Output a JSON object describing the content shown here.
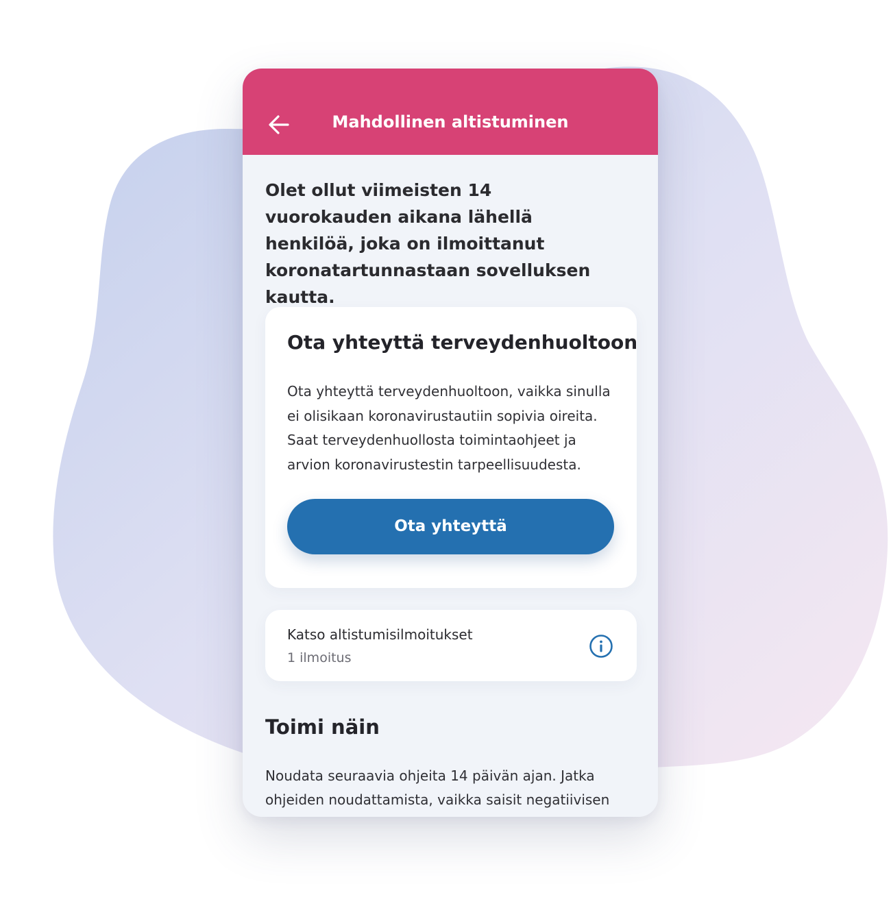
{
  "colors": {
    "header_bg": "#d74275",
    "primary_button": "#2470b0",
    "screen_bg": "#f1f4f9",
    "card_bg": "#ffffff",
    "info_icon": "#2470b0"
  },
  "header": {
    "back_icon": "arrow-left-icon",
    "title": "Mahdollinen altistuminen"
  },
  "intro": {
    "text": "Olet ollut viimeisten 14 vuorokauden aikana lähellä henkilöä, joka on ilmoittanut koronatartunnastaan sovelluksen kautta."
  },
  "contact_card": {
    "title": "Ota yhteyttä terveydenhuoltoon",
    "body": "Ota yhteyttä terveydenhuoltoon, vaikka sinulla ei olisikaan koronavirustautiin sopivia oireita. Saat terveydenhuollosta toimintaohjeet ja arvion koronavirustestin tarpeellisuudesta.",
    "button_label": "Ota yhteyttä"
  },
  "exposures_card": {
    "title": "Katso altistumisilmoitukset",
    "subtitle": "1 ilmoitus",
    "icon": "info-icon"
  },
  "instructions": {
    "title": "Toimi näin",
    "body": "Noudata seuraavia ohjeita 14 päivän ajan. Jatka ohjeiden noudattamista, vaikka saisit negatiivisen"
  }
}
